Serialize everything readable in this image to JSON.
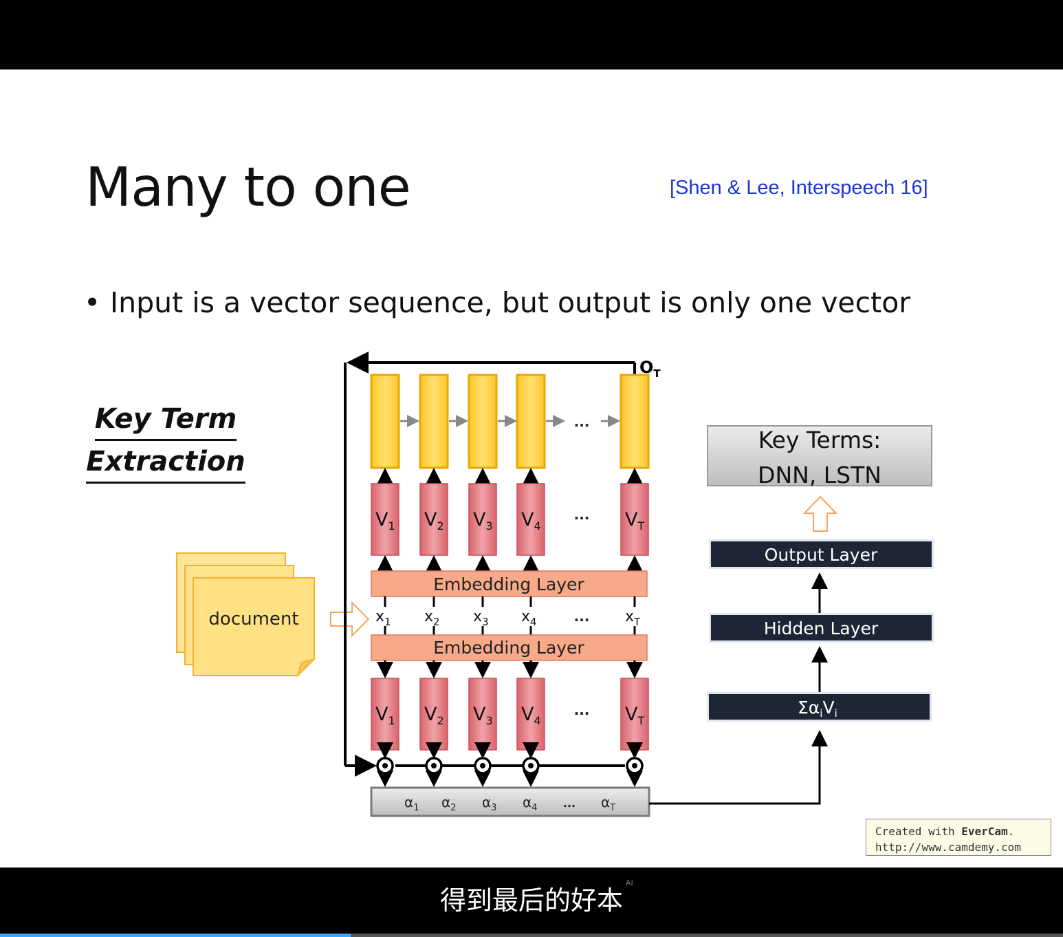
{
  "slide": {
    "title": "Many to one",
    "citation": "[Shen & Lee, Interspeech 16]",
    "bullet_mark": "•",
    "bullet": "Input is a vector sequence, but output is only one vector",
    "subtitle_line1": "Key Term",
    "subtitle_line2": "Extraction",
    "watermark_prefix": "Created with ",
    "watermark_brand": "EverCam",
    "watermark_suffix": ".",
    "watermark_url": "http://www.camdemy.com"
  },
  "diagram": {
    "document_label": "document",
    "output_label": "O",
    "output_sub": "T",
    "embedding_layer_top": "Embedding Layer",
    "embedding_layer_bottom": "Embedding Layer",
    "ellipsis": "...",
    "v_labels": [
      {
        "main": "V",
        "sub": "1"
      },
      {
        "main": "V",
        "sub": "2"
      },
      {
        "main": "V",
        "sub": "3"
      },
      {
        "main": "V",
        "sub": "4"
      },
      {
        "main": "V",
        "sub": "T"
      }
    ],
    "x_labels": [
      {
        "main": "x",
        "sub": "1"
      },
      {
        "main": "x",
        "sub": "2"
      },
      {
        "main": "x",
        "sub": "3"
      },
      {
        "main": "x",
        "sub": "4"
      },
      {
        "main": "x",
        "sub": "T"
      }
    ],
    "alpha_labels": [
      {
        "main": "α",
        "sub": "1"
      },
      {
        "main": "α",
        "sub": "2"
      },
      {
        "main": "α",
        "sub": "3"
      },
      {
        "main": "α",
        "sub": "4"
      },
      {
        "main": "α",
        "sub": "T"
      }
    ],
    "key_terms_line1": "Key Terms:",
    "key_terms_line2": "DNN, LSTN",
    "output_layer": "Output Layer",
    "hidden_layer": "Hidden Layer",
    "sum_main": "Σα",
    "sum_sub1": "i",
    "sum_main2": "V",
    "sum_sub2": "i"
  },
  "video": {
    "caption": "得到最后的好本",
    "ai_badge": "AI",
    "progress": 0.33
  },
  "colors": {
    "yellow_fill": "#ffd040",
    "yellow_stroke": "#e8a800",
    "pink_fill": "#e7838a",
    "salmon_fill": "#f8a98a",
    "dark_layer": "#1e2636",
    "citation_blue": "#1a34d8"
  }
}
